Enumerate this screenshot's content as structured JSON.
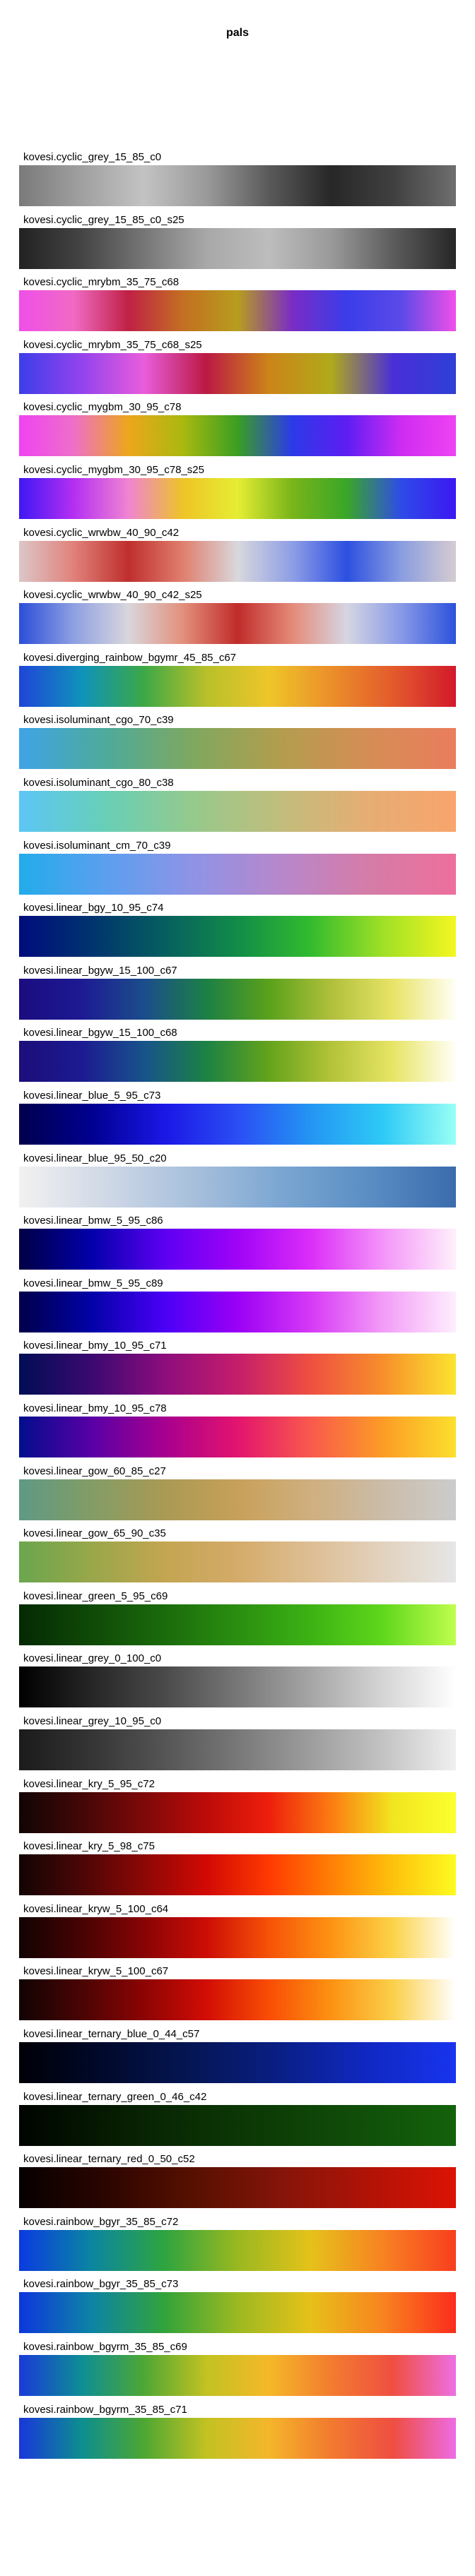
{
  "title": "pals",
  "chart_data": {
    "type": "heatmap",
    "title": "pals",
    "xlabel": "",
    "ylabel": "",
    "palettes": [
      {
        "name": "kovesi.cyclic_grey_15_85_c0",
        "colors": [
          "#7a7a7a",
          "#a0a0a0",
          "#c3c3c3",
          "#9a9a9a",
          "#5a5a5a",
          "#272727",
          "#404040",
          "#6f6f6f"
        ]
      },
      {
        "name": "kovesi.cyclic_grey_15_85_c0_s25",
        "colors": [
          "#222222",
          "#444444",
          "#767676",
          "#a8a8a8",
          "#bdbdbd",
          "#9a9a9a",
          "#5c5c5c",
          "#262626"
        ]
      },
      {
        "name": "kovesi.cyclic_mrybm_35_75_c68",
        "colors": [
          "#f04fe9",
          "#f06ac4",
          "#c02145",
          "#c36f22",
          "#b79d1d",
          "#7a2cc4",
          "#3a3de9",
          "#5b4ae8",
          "#f04fe9"
        ]
      },
      {
        "name": "kovesi.cyclic_mrybm_35_75_c68_s25",
        "colors": [
          "#3c3ee9",
          "#9343ee",
          "#e85ddb",
          "#bb1943",
          "#cc8419",
          "#b0aa1a",
          "#4a2ed8",
          "#2e3fd6"
        ]
      },
      {
        "name": "kovesi.cyclic_mygbm_30_95_c78",
        "colors": [
          "#ef43f2",
          "#ee6fc8",
          "#eda61c",
          "#a9b90f",
          "#3a9f22",
          "#2c3ae8",
          "#5d1ef2",
          "#ce2cf2",
          "#ef43f2"
        ]
      },
      {
        "name": "kovesi.cyclic_mygbm_30_95_c78_s25",
        "colors": [
          "#3f18f4",
          "#b42ff2",
          "#ef84d2",
          "#eec427",
          "#e6ed33",
          "#79b519",
          "#3aa628",
          "#2e4be8",
          "#3c18f2"
        ]
      },
      {
        "name": "kovesi.cyclic_wrwbw_40_90_c42",
        "colors": [
          "#dcc6c8",
          "#e0817a",
          "#bf2f2d",
          "#e07f6e",
          "#d8d8dc",
          "#8f9ee6",
          "#2c50e0",
          "#8a9de0",
          "#d6ccd0"
        ]
      },
      {
        "name": "kovesi.cyclic_wrwbw_40_90_c42_s25",
        "colors": [
          "#2c4ed8",
          "#8ea0e2",
          "#d9d6dc",
          "#e2907c",
          "#c02c2a",
          "#e48a78",
          "#d6d6e2",
          "#8899e6",
          "#2c52dc"
        ]
      },
      {
        "name": "kovesi.diverging_rainbow_bgymr_45_85_c67",
        "colors": [
          "#1f45d8",
          "#0f92bb",
          "#3ca846",
          "#b8c02a",
          "#eec629",
          "#eb8f2a",
          "#e35a2c",
          "#d2192b"
        ]
      },
      {
        "name": "kovesi.isoluminant_cgo_70_c39",
        "colors": [
          "#3fa4e6",
          "#4eaa9a",
          "#7fa85f",
          "#b39d4e",
          "#d58d55",
          "#ea7d5d"
        ]
      },
      {
        "name": "kovesi.isoluminant_cgo_80_c38",
        "colors": [
          "#5cc6f6",
          "#68cfb6",
          "#96c98c",
          "#c2bd7c",
          "#e6ad74",
          "#f8a56c"
        ]
      },
      {
        "name": "kovesi.isoluminant_cm_70_c39",
        "colors": [
          "#22acea",
          "#5c9fef",
          "#8f93e6",
          "#b787cb",
          "#d57ca8",
          "#ee6f9c"
        ]
      },
      {
        "name": "kovesi.linear_bgy_10_95_c74",
        "colors": [
          "#000c7d",
          "#00346f",
          "#065f5f",
          "#128c48",
          "#32bb2e",
          "#a0e026",
          "#f5f621"
        ]
      },
      {
        "name": "kovesi.linear_bgyw_15_100_c67",
        "colors": [
          "#1b0c80",
          "#1d1a93",
          "#1b4d8b",
          "#1c8045",
          "#5aa11a",
          "#b0c03b",
          "#e8e467",
          "#fffff6"
        ]
      },
      {
        "name": "kovesi.linear_bgyw_15_100_c68",
        "colors": [
          "#1c0d7a",
          "#1c1a92",
          "#18538a",
          "#1c8244",
          "#63a31b",
          "#b3c338",
          "#e8e566",
          "#fffff8"
        ]
      },
      {
        "name": "kovesi.linear_blue_5_95_c73",
        "colors": [
          "#00004c",
          "#000091",
          "#1b17e6",
          "#2a4df4",
          "#2495f3",
          "#2ecaf6",
          "#9afff6"
        ]
      },
      {
        "name": "kovesi.linear_blue_95_50_c20",
        "colors": [
          "#f1f1f1",
          "#cfd8e6",
          "#a7bfdc",
          "#7ba6d2",
          "#5a8ec3",
          "#3b6bad"
        ]
      },
      {
        "name": "kovesi.linear_bmw_5_95_c86",
        "colors": [
          "#000044",
          "#0300ab",
          "#5d00f2",
          "#a003f7",
          "#db2df8",
          "#f495f9",
          "#fef0fa"
        ]
      },
      {
        "name": "kovesi.linear_bmw_5_95_c89",
        "colors": [
          "#00004a",
          "#0202a8",
          "#4b00f6",
          "#9a00f5",
          "#d639f6",
          "#f39cf7",
          "#feeefe"
        ]
      },
      {
        "name": "kovesi.linear_bmy_10_95_c71",
        "colors": [
          "#000d55",
          "#3b0970",
          "#8d0d7d",
          "#c51d6b",
          "#ef4f41",
          "#f78f2b",
          "#fce430"
        ]
      },
      {
        "name": "kovesi.linear_bmy_10_95_c78",
        "colors": [
          "#020d8c",
          "#5900a6",
          "#a7008f",
          "#e3146e",
          "#f9594c",
          "#fc9c26",
          "#fbe02d"
        ]
      },
      {
        "name": "kovesi.linear_gow_60_85_c27",
        "colors": [
          "#5e9a84",
          "#839c66",
          "#aa9a54",
          "#c7a05a",
          "#cfaf7e",
          "#cbbca8",
          "#cccccc"
        ]
      },
      {
        "name": "kovesi.linear_gow_65_90_c35",
        "colors": [
          "#6aa64e",
          "#99a74a",
          "#c3a551",
          "#d4ab6a",
          "#ddbe93",
          "#e2d2be",
          "#e6e6e6"
        ]
      },
      {
        "name": "kovesi.linear_green_5_95_c69",
        "colors": [
          "#052904",
          "#0f4a07",
          "#1b6b0c",
          "#2a8e10",
          "#3cb214",
          "#5fd71c",
          "#c0ff4e"
        ]
      },
      {
        "name": "kovesi.linear_grey_0_100_c0",
        "colors": [
          "#000000",
          "#262626",
          "#4a4a4a",
          "#777777",
          "#a5a5a5",
          "#d5d5d5",
          "#ffffff"
        ]
      },
      {
        "name": "kovesi.linear_grey_10_95_c0",
        "colors": [
          "#1b1b1b",
          "#353535",
          "#555555",
          "#787878",
          "#9d9d9d",
          "#c3c3c3",
          "#f0f0f0"
        ]
      },
      {
        "name": "kovesi.linear_kry_5_95_c72",
        "colors": [
          "#120505",
          "#430707",
          "#7e0909",
          "#bc0b09",
          "#ee1f0c",
          "#fb7c12",
          "#f2e61f",
          "#fcff2e"
        ]
      },
      {
        "name": "kovesi.linear_kry_5_98_c75",
        "colors": [
          "#130404",
          "#4b0606",
          "#8b0806",
          "#d20904",
          "#fe3902",
          "#ff7f05",
          "#fdc20d",
          "#fdfb20"
        ]
      },
      {
        "name": "kovesi.linear_kryw_5_100_c64",
        "colors": [
          "#110303",
          "#470303",
          "#880405",
          "#cd0d06",
          "#f65208",
          "#fd9312",
          "#fcd349",
          "#ffffff"
        ]
      },
      {
        "name": "kovesi.linear_kryw_5_100_c67",
        "colors": [
          "#120303",
          "#4a0404",
          "#8c0404",
          "#d20d05",
          "#f94d05",
          "#fc9212",
          "#fbd04b",
          "#ffffff"
        ]
      },
      {
        "name": "kovesi.linear_ternary_blue_0_44_c57",
        "colors": [
          "#000007",
          "#010a2d",
          "#051655",
          "#0a1f86",
          "#1028c2",
          "#1834ee"
        ]
      },
      {
        "name": "kovesi.linear_ternary_green_0_46_c42",
        "colors": [
          "#000400",
          "#061a02",
          "#0a2e04",
          "#0d3e06",
          "#105009",
          "#13620b"
        ]
      },
      {
        "name": "kovesi.linear_ternary_red_0_50_c52",
        "colors": [
          "#060000",
          "#2c0500",
          "#571000",
          "#85140a",
          "#b01306",
          "#dc1304"
        ]
      },
      {
        "name": "kovesi.rainbow_bgyr_35_85_c72",
        "colors": [
          "#0b3ae1",
          "#0b86a0",
          "#2fa43f",
          "#99b820",
          "#e4c21a",
          "#f88222",
          "#f83e1e"
        ]
      },
      {
        "name": "kovesi.rainbow_bgyr_35_85_c73",
        "colors": [
          "#0d36de",
          "#0d84a4",
          "#32a33a",
          "#9cb921",
          "#e6c119",
          "#f8831f",
          "#fb2d1c"
        ]
      },
      {
        "name": "kovesi.rainbow_bgyrm_35_85_c69",
        "colors": [
          "#1a3ad8",
          "#0d8e95",
          "#4ea734",
          "#c2c222",
          "#f5b829",
          "#f27c2f",
          "#ef4f41",
          "#ee6fe3"
        ]
      },
      {
        "name": "kovesi.rainbow_bgyrm_35_85_c71",
        "colors": [
          "#1937da",
          "#0d8e90",
          "#4da733",
          "#c2c222",
          "#f4b62a",
          "#f27a2f",
          "#ef4e41",
          "#ee6ce4"
        ]
      }
    ]
  }
}
